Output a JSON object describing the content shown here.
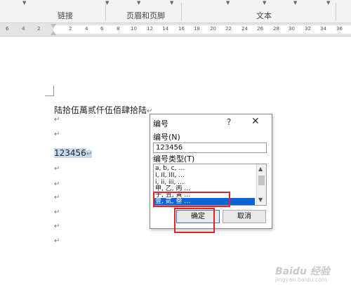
{
  "ribbon": {
    "groups": [
      "链接",
      "页眉和页脚",
      "文本"
    ]
  },
  "ruler": {
    "numbers": [
      "6",
      "4",
      "2",
      "2",
      "4",
      "6",
      "8",
      "10",
      "12",
      "14",
      "16",
      "18",
      "20",
      "22",
      "24",
      "26",
      "28",
      "30",
      "32",
      "34",
      "36"
    ]
  },
  "document": {
    "line1": "陆拾伍萬贰仟伍佰肆拾陆",
    "paragraph_mark": "↵",
    "selected_line": "123456"
  },
  "dialog": {
    "title": "编号",
    "help": "?",
    "close": "✕",
    "number_label": "编号(N)",
    "number_value": "123456",
    "type_label": "编号类型(T)",
    "types": [
      "a, b, c, …",
      "I, II, III, …",
      "i, ii, iii, …",
      "甲, 乙, 丙 …",
      "子, 丑, 寅 …",
      "壹, 贰, 叁 …"
    ],
    "selected_type_index": 5,
    "ok_label": "确定",
    "cancel_label": "取消"
  },
  "watermark": {
    "brand": "Baidu 经验",
    "url": "jingyan.baidu.com"
  },
  "colors": {
    "highlight_box": "#e4222a",
    "selection_blue": "#0a64d6",
    "text_selection": "#c6dbf0"
  }
}
